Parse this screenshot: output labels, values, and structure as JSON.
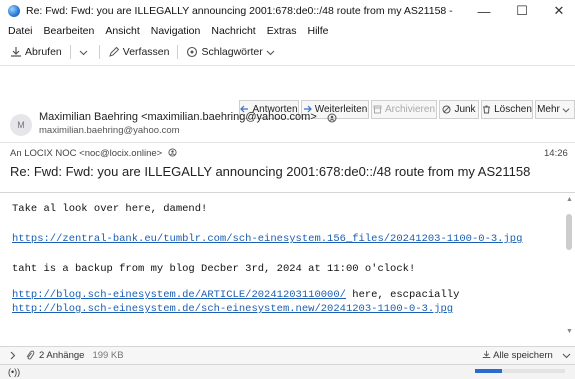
{
  "window": {
    "title": "Re: Fwd: Fwd: you are ILLEGALLY announcing 2001:678:de0::/48 route from my AS21158 - Mozill...",
    "minimize_glyph": "—",
    "maximize_glyph": "☐",
    "close_glyph": "✕"
  },
  "menu": {
    "items": [
      "Datei",
      "Bearbeiten",
      "Ansicht",
      "Navigation",
      "Nachricht",
      "Extras",
      "Hilfe"
    ]
  },
  "toolbar": {
    "get_messages": "Abrufen",
    "write": "Verfassen",
    "tags": "Schlagwörter"
  },
  "header_buttons": {
    "reply": "Antworten",
    "forward": "Weiterleiten",
    "archive": "Archivieren",
    "junk": "Junk",
    "delete": "Löschen",
    "more": "Mehr"
  },
  "message": {
    "avatar_initial": "M",
    "from_name": "Maximilian Baehring <maximilian.baehring@yahoo.com>",
    "from_email": "maximilian.baehring@yahoo.com",
    "to": "An  LOCIX NOC <noc@locix.online>",
    "time": "14:26",
    "subject": "Re: Fwd: Fwd: you are ILLEGALLY announcing 2001:678:de0::/48 route from my AS21158",
    "body": {
      "line1": "Take al look over here, damend!",
      "link1": "https://zentral-bank.eu/tumblr.com/sch-einesystem.156_files/20241203-1100-0-3.jpg",
      "line2": "taht is a backup from my blog Decber 3rd, 2024 at 11:00 o'clock!",
      "link2": "http://blog.sch-einesystem.de/ARTICLE/20241203110000/",
      "link2_suffix": " here, escpacially",
      "link3": "http://blog.sch-einesystem.de/sch-einesystem.new/20241203-1100-0-3.jpg"
    }
  },
  "attachments": {
    "label": "2 Anhänge",
    "size": "199 KB",
    "save_all": "Alle speichern"
  },
  "status": {
    "text": "(•))",
    "progress_percent": 30
  },
  "colors": {
    "link": "#1a5fb4",
    "progress": "#2a6bd0"
  }
}
